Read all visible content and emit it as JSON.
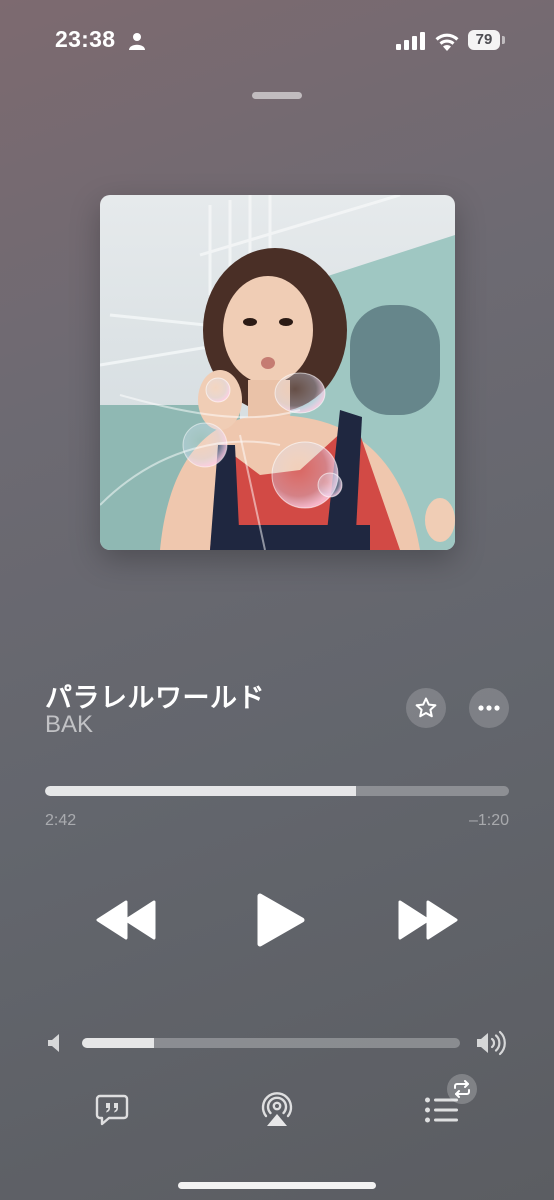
{
  "status_bar": {
    "time": "23:38",
    "battery_level": "79",
    "icons": [
      "person-icon",
      "signal-icon",
      "wifi-icon",
      "battery-icon"
    ]
  },
  "now_playing": {
    "title": "パラレルワールド",
    "artist": "BAK",
    "artwork_icon": "album-artwork"
  },
  "playback": {
    "elapsed": "2:42",
    "remaining": "–1:20",
    "progress_fraction": 0.67
  },
  "controls": {
    "icons": [
      "rewind-icon",
      "play-icon",
      "fast-forward-icon"
    ]
  },
  "volume": {
    "level_fraction": 0.19,
    "icons": [
      "volume-low-icon",
      "volume-high-icon"
    ]
  },
  "bottom_bar": {
    "icons": [
      "lyrics-icon",
      "airplay-icon",
      "queue-icon",
      "repeat-icon"
    ]
  },
  "colors": {
    "background_top": "#7d6a70",
    "background_bottom": "#5b5d62",
    "progress_fill": "#c9c9cc",
    "progress_track": "#7f8086"
  }
}
